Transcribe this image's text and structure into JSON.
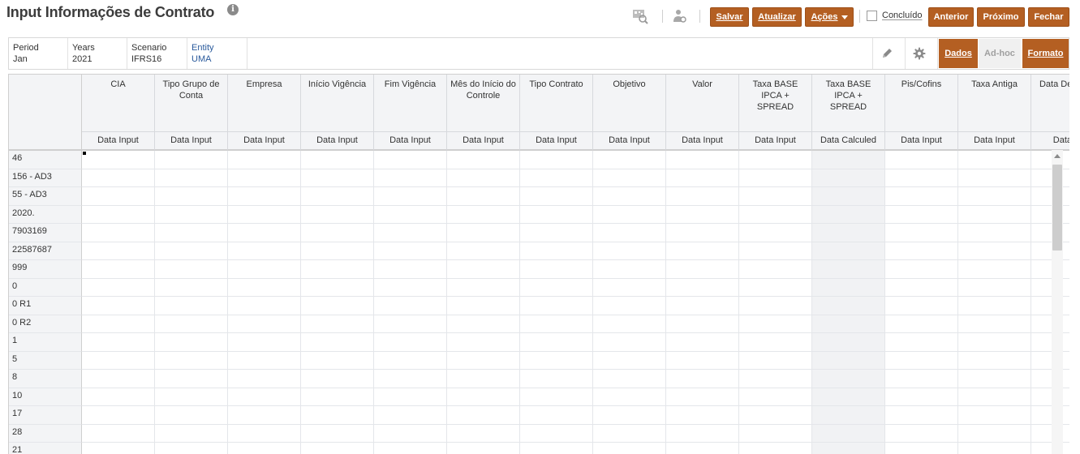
{
  "page": {
    "title": "Input Informações de Contrato",
    "info_icon": "info-icon",
    "glyph_info": "i"
  },
  "toolbar": {
    "tool_icons": [
      "qr-search-icon",
      "user-settings-icon"
    ],
    "save_label": "Salvar",
    "refresh_label": "Atualizar",
    "actions_label": "Ações",
    "done_label": "Concluído",
    "done_checked": false,
    "previous_label": "Anterior",
    "next_label": "Próximo",
    "close_label": "Fechar",
    "accent_color": "#b45f22"
  },
  "pov": {
    "items": [
      {
        "label": "Period",
        "value": "Jan"
      },
      {
        "label": "Years",
        "value": "2021"
      },
      {
        "label": "Scenario",
        "value": "IFRS16"
      },
      {
        "label": "Entity",
        "value": "UMA"
      }
    ],
    "icons": [
      "pencil-icon",
      "gear-icon"
    ],
    "tabs": [
      {
        "label": "Dados",
        "active": true
      },
      {
        "label": "Ad-hoc",
        "active": false
      },
      {
        "label": "Formato",
        "active": true
      }
    ]
  },
  "grid": {
    "columns": [
      {
        "header": "CIA",
        "sub": "Data Input"
      },
      {
        "header": "Tipo Grupo de Conta",
        "sub": "Data Input"
      },
      {
        "header": "Empresa",
        "sub": "Data Input"
      },
      {
        "header": "Início Vigência",
        "sub": "Data Input"
      },
      {
        "header": "Fim Vigência",
        "sub": "Data Input"
      },
      {
        "header": "Mês do Início do Controle",
        "sub": "Data Input"
      },
      {
        "header": "Tipo Contrato",
        "sub": "Data Input"
      },
      {
        "header": "Objetivo",
        "sub": "Data Input"
      },
      {
        "header": "Valor",
        "sub": "Data Input"
      },
      {
        "header": "Taxa BASE IPCA + SPREAD",
        "sub": "Data Input"
      },
      {
        "header": "Taxa BASE IPCA + SPREAD",
        "sub": "Data Calculed"
      },
      {
        "header": "Pis/Cofins",
        "sub": "Data Input"
      },
      {
        "header": "Taxa Antiga",
        "sub": "Data Input"
      },
      {
        "header": "Data Desconti",
        "sub": "Data In"
      }
    ],
    "rows": [
      "46",
      "156 - AD3",
      "55 - AD3",
      "2020.",
      "7903169",
      "22587687",
      "999",
      "0",
      "0 R1",
      "0 R2",
      "1",
      "5",
      "8",
      "10",
      "17",
      "28",
      "21"
    ]
  }
}
